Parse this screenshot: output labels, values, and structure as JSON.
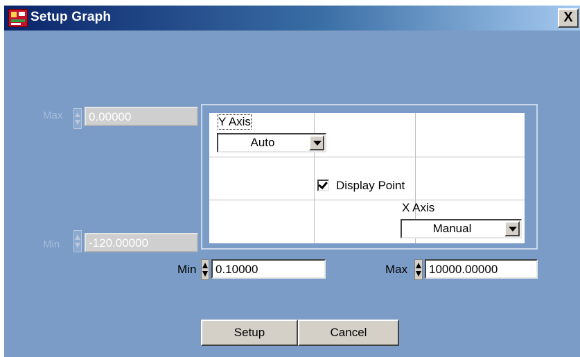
{
  "window": {
    "title": "Setup Graph",
    "close_glyph": "X"
  },
  "y_range": {
    "max": {
      "label": "Max",
      "value": "0.00000"
    },
    "min": {
      "label": "Min",
      "value": "-120.00000"
    }
  },
  "graph": {
    "y_axis": {
      "label": "Y Axis",
      "mode": "Auto"
    },
    "display_point": {
      "label": "Display Point",
      "checked": true
    },
    "x_axis": {
      "label": "X Axis",
      "mode": "Manual"
    }
  },
  "x_range": {
    "min": {
      "label": "Min",
      "value": "0.10000"
    },
    "max": {
      "label": "Max",
      "value": "10000.00000"
    }
  },
  "buttons": {
    "setup": "Setup",
    "cancel": "Cancel"
  }
}
